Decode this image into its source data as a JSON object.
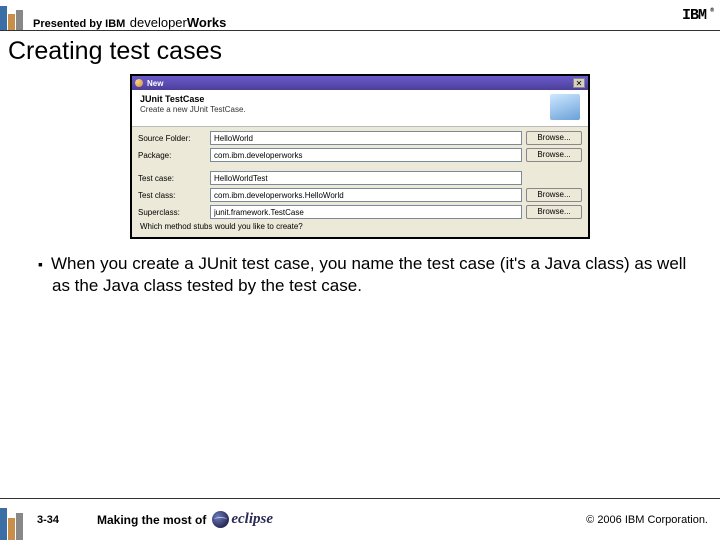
{
  "header": {
    "presented": "Presented by IBM",
    "dw_light": "developer",
    "dw_bold": "Works",
    "ibm": "IBM"
  },
  "title": "Creating test cases",
  "dialog": {
    "window_title": "New",
    "head_title": "JUnit TestCase",
    "head_sub": "Create a new JUnit TestCase.",
    "rows": {
      "source_folder": {
        "label": "Source Folder:",
        "value": "HelloWorld",
        "button": "Browse..."
      },
      "package": {
        "label": "Package:",
        "value": "com.ibm.developerworks",
        "button": "Browse..."
      },
      "test_case": {
        "label": "Test case:",
        "value": "HelloWorldTest"
      },
      "test_class": {
        "label": "Test class:",
        "value": "com.ibm.developerworks.HelloWorld",
        "button": "Browse..."
      },
      "superclass": {
        "label": "Superclass:",
        "value": "junit.framework.TestCase",
        "button": "Browse..."
      }
    },
    "question": "Which method stubs would you like to create?"
  },
  "bullet": "When you create a JUnit test case, you name the test case (it's a Java class) as well as the Java class tested by the test case.",
  "footer": {
    "page": "3-34",
    "making": "Making the most of",
    "eclipse": "eclipse",
    "copyright": "© 2006 IBM Corporation."
  }
}
